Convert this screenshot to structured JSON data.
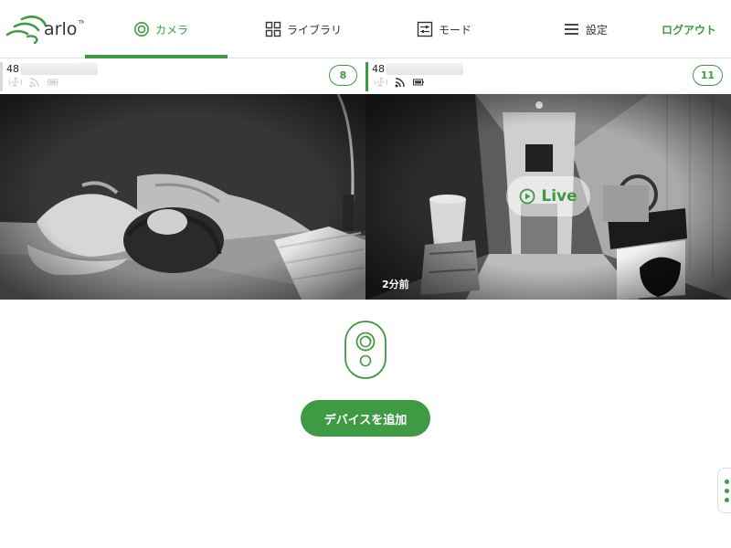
{
  "brand": {
    "name": "arlo",
    "accent": "#3f9b43"
  },
  "nav": {
    "items": [
      {
        "label": "カメラ",
        "icon": "camera-icon",
        "active": true
      },
      {
        "label": "ライブラリ",
        "icon": "grid-icon",
        "active": false
      },
      {
        "label": "モード",
        "icon": "sliders-icon",
        "active": false
      },
      {
        "label": "設定",
        "icon": "menu-icon",
        "active": false
      }
    ],
    "logout_label": "ログアウト"
  },
  "cameras": [
    {
      "name_prefix": "48",
      "event_count": "8",
      "status_icons": [
        "motion-icon",
        "wifi-icon",
        "battery-icon"
      ],
      "live_label": "",
      "time_label": ""
    },
    {
      "name_prefix": "48",
      "event_count": "11",
      "status_icons": [
        "motion-icon",
        "wifi-icon",
        "battery-icon"
      ],
      "live_label": "Live",
      "time_label": "2分前"
    }
  ],
  "add_device": {
    "label": "デバイスを追加",
    "icon": "camera-device-icon"
  }
}
